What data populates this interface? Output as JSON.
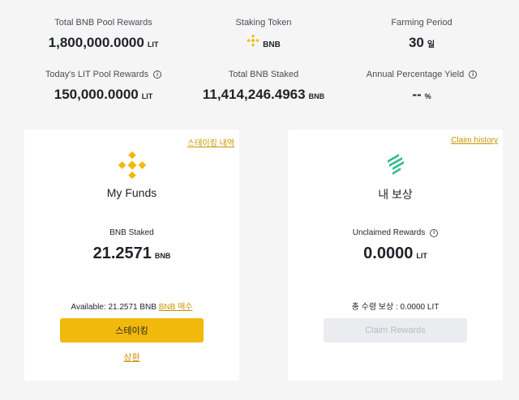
{
  "stats": {
    "total_pool": {
      "label": "Total BNB Pool Rewards",
      "value": "1,800,000.0000",
      "unit": "LIT"
    },
    "staking_token": {
      "label": "Staking Token",
      "token": "BNB",
      "icon": "bnb-icon"
    },
    "farming_period": {
      "label": "Farming Period",
      "value": "30",
      "unit": "일"
    },
    "today_pool": {
      "label": "Today's LIT Pool Rewards",
      "value": "150,000.0000",
      "unit": "LIT"
    },
    "total_staked": {
      "label": "Total BNB Staked",
      "value": "11,414,246.4963",
      "unit": "BNB"
    },
    "apy": {
      "label": "Annual Percentage Yield",
      "value": "--",
      "unit": "%"
    }
  },
  "my_funds": {
    "history_link": "스테이킹 내역",
    "title": "My Funds",
    "metric_label": "BNB Staked",
    "metric_value": "21.2571",
    "metric_unit": "BNB",
    "available_prefix": "Available: 21.2571 BNB",
    "buy_link": "BNB 매수",
    "stake_button": "스테이킹",
    "redeem_link": "상환"
  },
  "my_rewards": {
    "history_link": "Claim history",
    "title": "내 보상",
    "metric_label": "Unclaimed Rewards",
    "metric_value": "0.0000",
    "metric_unit": "LIT",
    "received": "총 수령 보상 : 0.0000 LIT",
    "claim_button": "Claim Rewards"
  },
  "colors": {
    "accent": "#f0b90b",
    "link": "#c99400",
    "lit_green": "#2ebd85",
    "background": "#f5f5f5"
  }
}
